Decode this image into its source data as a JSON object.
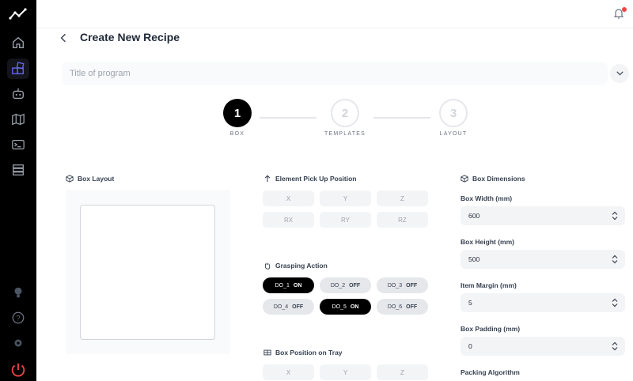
{
  "page": {
    "title": "Create New Recipe"
  },
  "program": {
    "placeholder": "Title of program"
  },
  "steps": [
    {
      "number": "1",
      "label": "BOX"
    },
    {
      "number": "2",
      "label": "TEMPLATES"
    },
    {
      "number": "3",
      "label": "LAYOUT"
    }
  ],
  "box_layout": {
    "heading": "Box Layout"
  },
  "pickup": {
    "heading": "Element Pick Up Position",
    "axes": [
      "X",
      "Y",
      "Z",
      "RX",
      "RY",
      "RZ"
    ]
  },
  "grasping": {
    "heading": "Grasping Action",
    "outputs": [
      {
        "name": "DO_1",
        "state": "ON",
        "on": true
      },
      {
        "name": "DO_2",
        "state": "OFF",
        "on": false
      },
      {
        "name": "DO_3",
        "state": "OFF",
        "on": false
      },
      {
        "name": "DO_4",
        "state": "OFF",
        "on": false
      },
      {
        "name": "DO_5",
        "state": "ON",
        "on": true
      },
      {
        "name": "DO_6",
        "state": "OFF",
        "on": false
      }
    ]
  },
  "tray": {
    "heading": "Box Position on Tray",
    "axes": [
      "X",
      "Y",
      "Z"
    ]
  },
  "dimensions": {
    "heading": "Box Dimensions",
    "fields": [
      {
        "label": "Box Width (mm)",
        "value": "600"
      },
      {
        "label": "Box Height (mm)",
        "value": "500"
      },
      {
        "label": "Item Margin (mm)",
        "value": "5"
      },
      {
        "label": "Box Padding (mm)",
        "value": "0"
      }
    ],
    "packing_label": "Packing Algorithm"
  },
  "colors": {
    "active": "#000000",
    "notification": "#ef4444",
    "power": "#ef4444"
  },
  "sidebar": {
    "icons": [
      "logo-chart-icon",
      "home-icon",
      "recipes-icon",
      "robot-icon",
      "map-icon",
      "terminal-icon",
      "storage-icon",
      "lightbulb-icon",
      "help-icon",
      "settings-icon",
      "power-icon"
    ]
  }
}
